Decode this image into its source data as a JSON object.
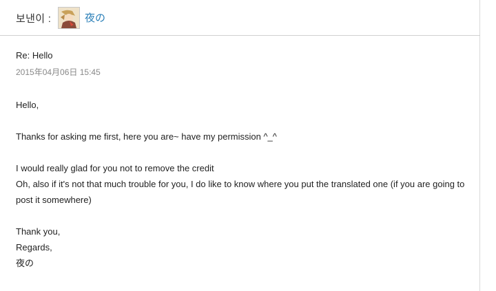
{
  "header": {
    "sender_label": "보낸이 :",
    "sender_name": "夜の"
  },
  "message": {
    "subject": "Re: Hello",
    "date": "2015年04月06日 15:45",
    "body": {
      "greeting": "Hello,",
      "line1": "Thanks for asking me first, here you are~ have my permission ^_^",
      "line2": "I would really glad for you not to remove the credit",
      "line3a": "Oh, also if it's not that much trouble for you, I do like to know where you put the translated one (if you are going to",
      "line3b": "post it somewhere)",
      "closing1": "Thank you,",
      "closing2": "Regards,",
      "signature": "夜の"
    }
  },
  "colors": {
    "link": "#2a7fb8",
    "date": "#888888",
    "divider": "#cfcfcf"
  }
}
